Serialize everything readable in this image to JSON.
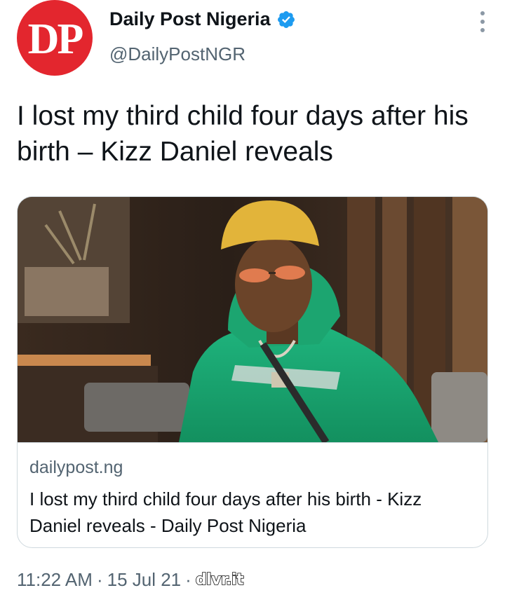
{
  "account": {
    "avatar_text": "DP",
    "display_name": "Daily Post Nigeria",
    "handle": "@DailyPostNGR",
    "verified_icon": "verified-badge-icon",
    "more_icon": "more-options-icon"
  },
  "tweet": {
    "text": "I lost my third child four days after his birth – Kizz Daniel reveals"
  },
  "link_card": {
    "domain": "dailypost.ng",
    "title": "I lost my third child four days after his birth - Kizz Daniel reveals - Daily Post Nigeria"
  },
  "meta": {
    "time": "11:22 AM",
    "separator": "·",
    "date": "15 Jul 21",
    "source": "dlvr.it"
  },
  "colors": {
    "avatar_bg": "#e3262e",
    "verified_blue": "#1d9bf0",
    "secondary_text": "#536471",
    "border": "#cfd9de"
  }
}
